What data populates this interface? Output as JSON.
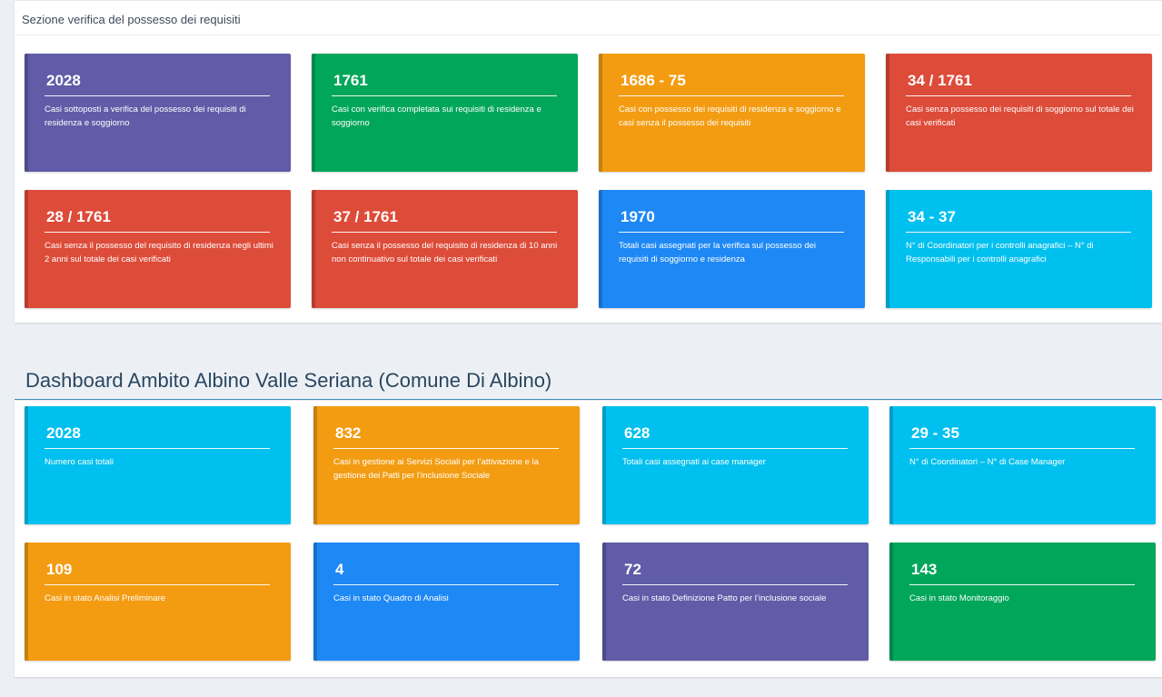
{
  "section1": {
    "header": "Sezione verifica del possesso dei requisiti",
    "cards": [
      {
        "value": "2028",
        "description": "Casi sottoposti a verifica del possesso dei requisiti di residenza e soggiorno",
        "color": "#605ca8"
      },
      {
        "value": "1761",
        "description": "Casi con verifica completata sui requisiti di residenza e soggiorno",
        "color": "#00a65a"
      },
      {
        "value": "1686 - 75",
        "description": "Casi con possesso dei requisiti di residenza e soggiorno e casi senza il possesso dei requisiti",
        "color": "#f39c12"
      },
      {
        "value": "34 / 1761",
        "description": "Casi senza possesso dei requisiti di soggiorno sul totale dei casi verificati",
        "color": "#dd4b39"
      },
      {
        "value": "28 / 1761",
        "description": "Casi senza il possesso del requisito di residenza negli ultimi 2 anni sul totale dei casi verificati",
        "color": "#dd4b39"
      },
      {
        "value": "37 / 1761",
        "description": "Casi senza il possesso del requisito di residenza di 10 anni non continuativo sul totale dei casi verificati",
        "color": "#dd4b39"
      },
      {
        "value": "1970",
        "description": "Totali casi assegnati per la verifica sul possesso dei requisiti di soggiorno e residenza",
        "color": "#1e88f5"
      },
      {
        "value": "34 - 37",
        "description": "N° di Coordinatori per i controlli anagrafici – N° di Responsabili per i controlli anagrafici",
        "color": "#00c0ef"
      }
    ]
  },
  "section2": {
    "title": "Dashboard Ambito Albino Valle Seriana (Comune Di Albino)",
    "cards": [
      {
        "value": "2028",
        "description": "Numero casi totali",
        "color": "#00c0ef"
      },
      {
        "value": "832",
        "description": "Casi in gestione ai Servizi Sociali per l’attivazione e la gestione dei Patti per l’inclusione Sociale",
        "color": "#f39c12"
      },
      {
        "value": "628",
        "description": "Totali casi assegnati ai case manager",
        "color": "#00c0ef"
      },
      {
        "value": "29 - 35",
        "description": "N° di Coordinatori – N° di Case Manager",
        "color": "#00c0ef"
      },
      {
        "value": "109",
        "description": "Casi in stato Analisi Preliminare",
        "color": "#f39c12"
      },
      {
        "value": "4",
        "description": "Casi in stato Quadro di Analisi",
        "color": "#1e88f5"
      },
      {
        "value": "72",
        "description": "Casi in stato Definizione Patto per l’inclusione sociale",
        "color": "#605ca8"
      },
      {
        "value": "143",
        "description": "Casi in stato Monitoraggio",
        "color": "#00a65a"
      }
    ]
  }
}
